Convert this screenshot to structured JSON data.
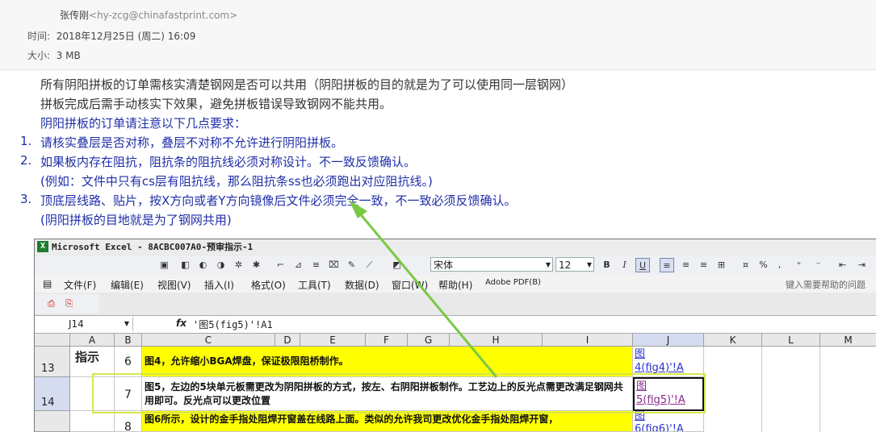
{
  "email": {
    "sender_name": "张传刚",
    "sender_email": "<hy-zcg@chinafastprint.com>",
    "time_label": "时间:",
    "time_value": "2018年12月25日 (周二) 16:09",
    "size_label": "大小:",
    "size_value": "3 MB"
  },
  "body": {
    "line1": "所有阴阳拼板的订单需核实清楚钢网是否可以共用（阴阳拼板的目的就是为了可以使用同一层钢网）",
    "line2": "拼板完成后需手动核实下效果，避免拼板错误导致钢网不能共用。",
    "line3": "阴阳拼板的订单请注意以下几点要求：",
    "items": [
      {
        "num": "1.",
        "text": "请核实叠层是否对称，叠层不对称不允许进行阴阳拼板。"
      },
      {
        "num": "2.",
        "text": "如果板内存在阻抗，阻抗条的阻抗线必须对称设计。不一致反馈确认。"
      },
      {
        "num": "",
        "text": "(例如：文件中只有cs层有阻抗线，那么阻抗条ss也必须跑出对应阻抗线。)"
      },
      {
        "num": "3.",
        "text": "顶底层线路、贴片，按X方向或者Y方向镜像后文件必须完全一致，不一致必须反馈确认。"
      },
      {
        "num": "",
        "text": "(阴阳拼板的目地就是为了钢网共用)"
      }
    ]
  },
  "excel": {
    "title": "Microsoft Excel - 8ACBC007A0-预审指示-1",
    "font_name": "宋体",
    "font_size": "12",
    "menu": [
      "文件(F)",
      "编辑(E)",
      "视图(V)",
      "插入(I)",
      "格式(O)",
      "工具(T)",
      "数据(D)",
      "窗口(W)",
      "帮助(H)",
      "Adobe PDF(B)"
    ],
    "help_placeholder": "键入需要帮助的问题",
    "namebox": "J14",
    "fx": "fx",
    "formula": "'图5(fig5)'!A1",
    "columns": [
      "A",
      "B",
      "C",
      "D",
      "E",
      "F",
      "G",
      "H",
      "I",
      "J",
      "K",
      "L",
      "M"
    ],
    "rows": [
      {
        "num": "13",
        "a": "指示",
        "b": "6",
        "c": "图4，允许缩小BGA焊盘，保证极限阻桥制作。",
        "j1": "图",
        "j2": "4(fig4)'!A"
      },
      {
        "num": "14",
        "a": "",
        "b": "7",
        "c": "图5，左边的5块单元板需更改为阴阳拼板的方式，按左、右阴阳拼板制作。工艺边上的反光点需更改满足钢网共用即可。反光点可以更改位置",
        "j1": "图",
        "j2": "5(fig5)'!A"
      },
      {
        "num": "",
        "a": "",
        "b": "8",
        "c": "图6所示，设计的金手指处阻焊开窗盖在线路上面。类似的允许我司更改优化金手指处阻焊开窗，",
        "j1": "图",
        "j2": "6(fig6)'!A"
      }
    ],
    "colors": {
      "highlight_border": "#d8e84a",
      "arrow": "#7ac943",
      "cell_yellow": "#ffff00"
    }
  }
}
